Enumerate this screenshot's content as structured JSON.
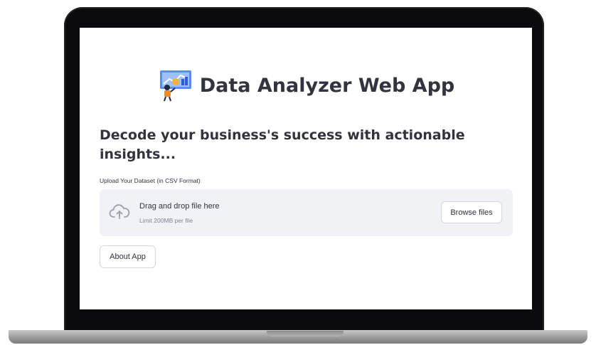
{
  "app": {
    "title": "Data Analyzer Web App",
    "subtitle": "Decode your business's success with actionable insights...",
    "logo_icon": "data-analyst-presentation-icon"
  },
  "uploader": {
    "label": "Upload Your Dataset (in CSV Format)",
    "drop_text": "Drag and drop file here",
    "limit_text": "Limit 200MB per file",
    "browse_label": "Browse files",
    "icon": "cloud-upload-icon"
  },
  "about_button": {
    "label": "About App"
  },
  "colors": {
    "text": "#31333f",
    "muted_text": "#808495",
    "dropzone_bg": "#f0f2f6",
    "laptop_bezel": "#0b0b0d",
    "laptop_base": "#9a9a9a"
  }
}
